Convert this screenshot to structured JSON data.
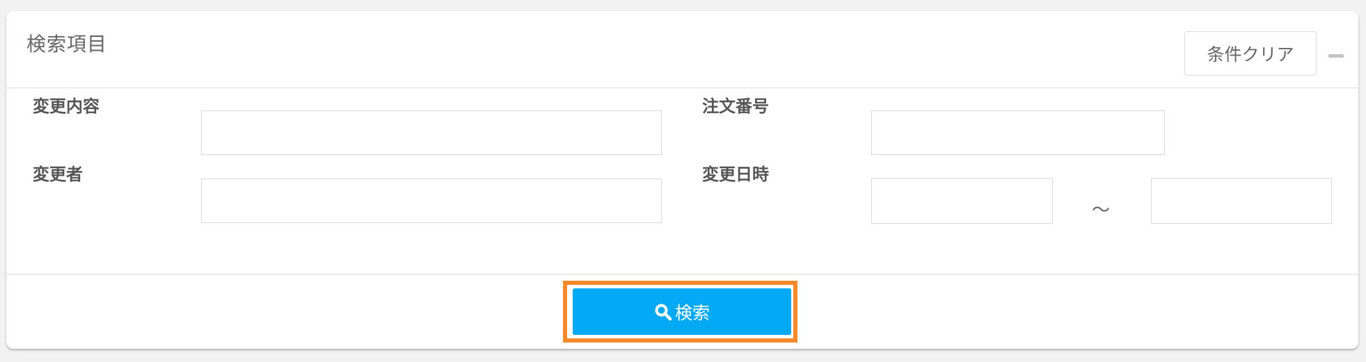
{
  "panel": {
    "title": "検索項目",
    "clear_label": "条件クリア"
  },
  "fields": {
    "change_content": {
      "label": "変更内容",
      "value": ""
    },
    "order_number": {
      "label": "注文番号",
      "value": ""
    },
    "changed_by": {
      "label": "変更者",
      "value": ""
    },
    "changed_at": {
      "label": "変更日時",
      "from": "",
      "to": "",
      "separator": "～"
    }
  },
  "actions": {
    "search_label": "検索",
    "search_icon": "search-icon",
    "search_color": "#03a9f4",
    "highlight_color": "#f58a2c"
  }
}
